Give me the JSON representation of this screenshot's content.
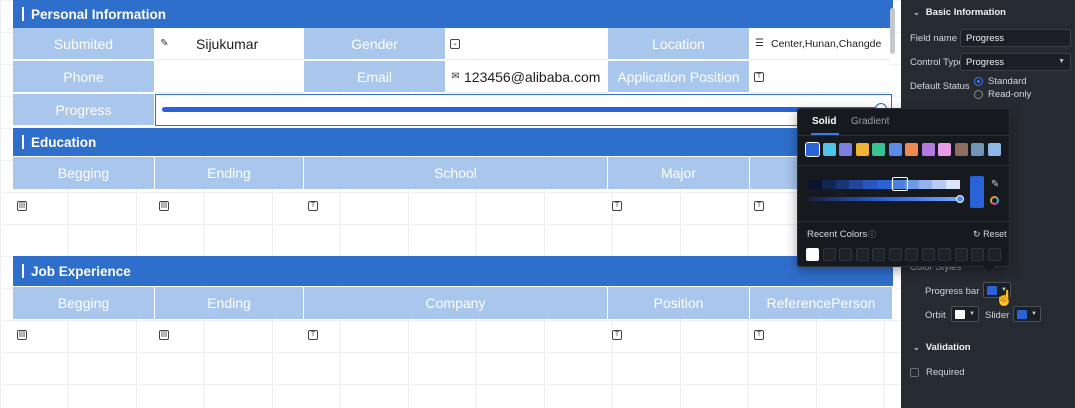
{
  "sections": {
    "personal": "Personal Information",
    "education": "Education",
    "job": "Job Experience"
  },
  "personal_fields": {
    "submitted_label": "Submited",
    "submitted_value": "Sijukumar",
    "gender_label": "Gender",
    "gender_value": "",
    "location_label": "Location",
    "location_value": "Center,Hunan,Changde",
    "phone_label": "Phone",
    "phone_value": "",
    "email_label": "Email",
    "email_value": "123456@alibaba.com",
    "application_position_label": "Application Position",
    "application_position_value": "",
    "progress_label": "Progress",
    "progress_value": 1.0
  },
  "education_columns": [
    "Begging",
    "Ending",
    "School",
    "Major",
    ""
  ],
  "job_columns": [
    "Begging",
    "Ending",
    "Company",
    "Position",
    "ReferencePerson"
  ],
  "panel": {
    "basic_info_title": "Basic Information",
    "field_name_label": "Field name",
    "field_name_value": "Progress",
    "control_type_label": "Control Type",
    "control_type_value": "Progress",
    "default_status_label": "Default Status",
    "status_options": [
      "Standard",
      "Read-only"
    ],
    "status_selected": "Standard",
    "color_styles_label": "Color Styles",
    "progress_bar_label": "Progress bar",
    "orbit_label": "Orbit",
    "slider_label": "Slider",
    "validation_title": "Validation",
    "required_label": "Required"
  },
  "colors": {
    "progress_bar": "#2a63d8",
    "orbit": "#ffffff",
    "slider": "#2a63d8",
    "header_blue": "#2f6fcc",
    "label_blue": "#a9c6ec"
  },
  "color_picker": {
    "tab_solid": "Solid",
    "tab_gradient": "Gradient",
    "active_tab": "Solid",
    "presets": [
      "#2a63d8",
      "#4fc3e8",
      "#7b7fe0",
      "#f2b233",
      "#3cc193",
      "#5a8be8",
      "#f08a55",
      "#b57ae0",
      "#e79be8",
      "#8e6e60",
      "#6f95b8",
      "#8fb7e8"
    ],
    "shades": [
      "#0b1530",
      "#122652",
      "#1a3676",
      "#21469a",
      "#2a57bf",
      "#2a63d8",
      "#4d80e0",
      "#7099e6",
      "#93b2ec",
      "#b7cbf2",
      "#dbe5f8"
    ],
    "recent_colors_label": "Recent Colors",
    "reset_label": "Reset",
    "recent_colors": [
      "#ffffff"
    ]
  }
}
